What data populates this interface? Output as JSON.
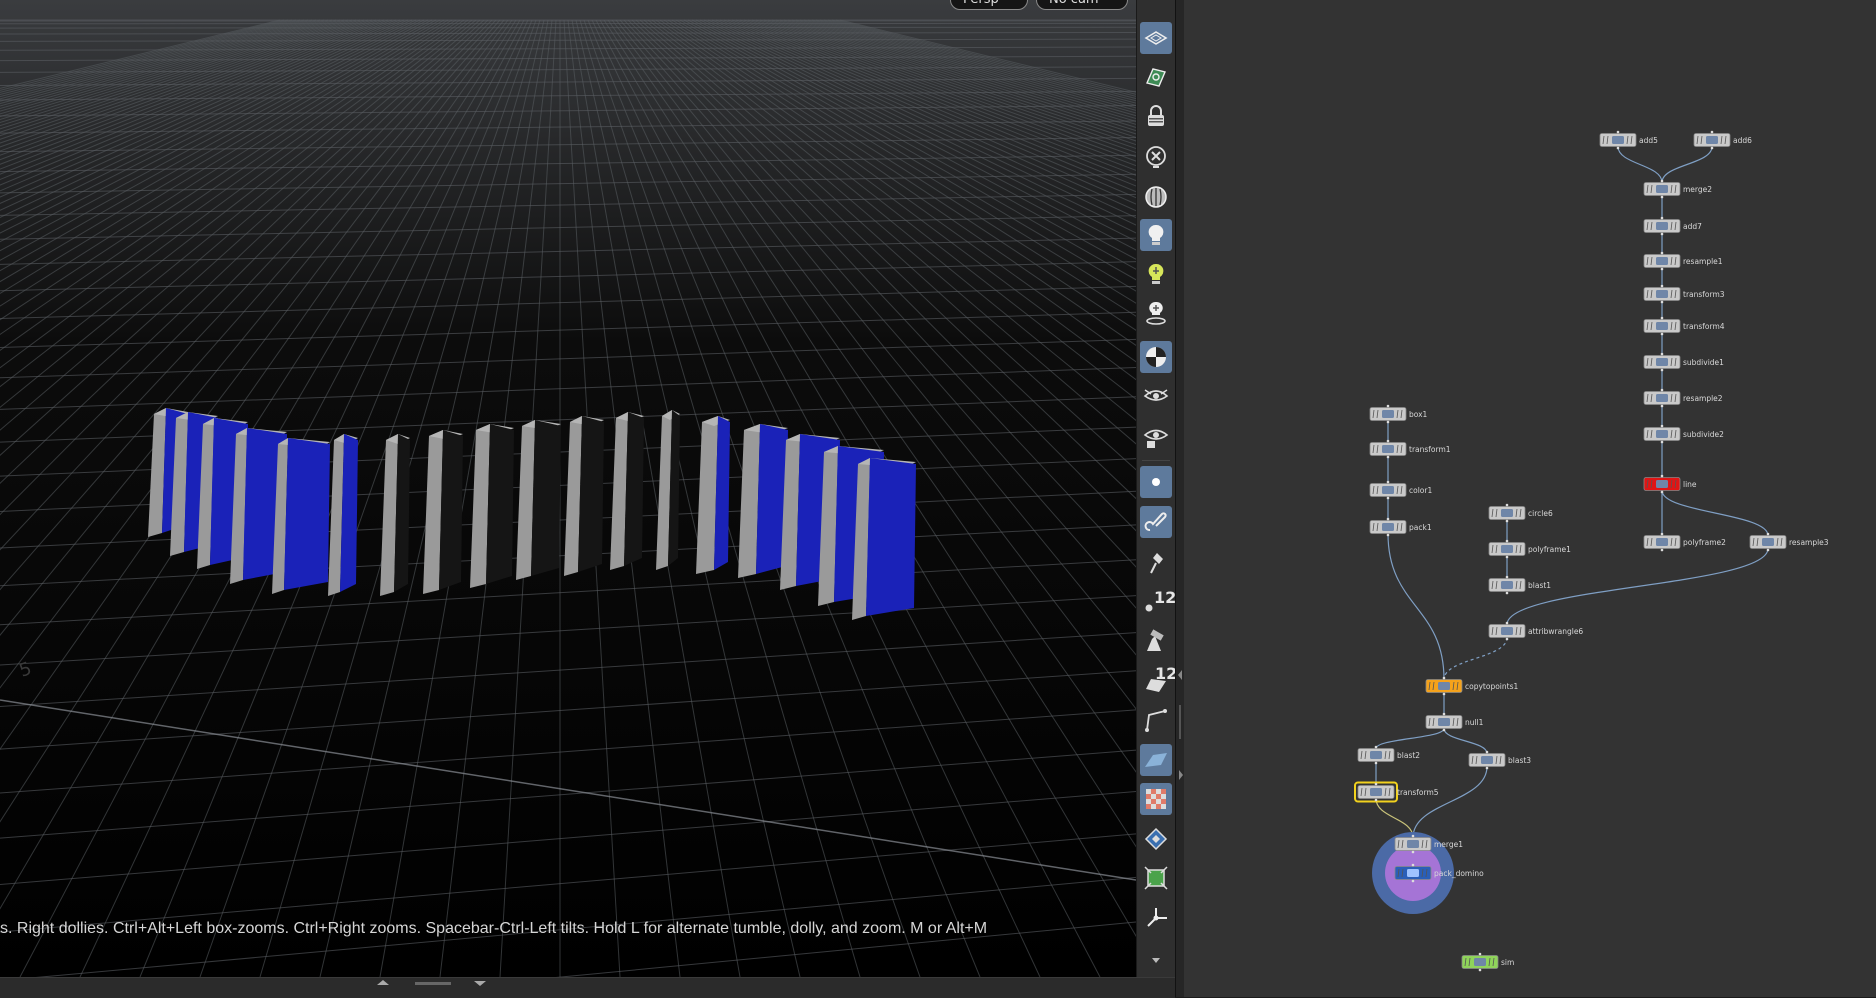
{
  "viewport": {
    "top_buttons": [
      "Persp",
      "No cam"
    ],
    "hint_text": "s. Right dollies. Ctrl+Alt+Left box-zooms. Ctrl+Right zooms. Spacebar-Ctrl-Left tilts. Hold L for alternate tumble, dolly, and zoom.    M or Alt+M",
    "grid_label": "5",
    "colors": {
      "domino_blue": "#1a22b8",
      "domino_side": "#9a9a9a",
      "domino_black": "#151515",
      "background": "#000000"
    }
  },
  "toolbar": {
    "icons": [
      "select-mode-icon",
      "snap-icon",
      "lock-camera-icon",
      "hide-icon",
      "wireframe-icon",
      "headlight-icon",
      "normal-light-icon",
      "high-light-icon",
      "shaded-icon",
      "display-options-icon",
      "visualizer-icon",
      "point-icon",
      "paint-icon",
      "pin-icon",
      "display-points-icon",
      "measure-icon",
      "display-count-icon",
      "edge-icon",
      "ground-plane-icon",
      "checker-icon",
      "vertex-icon",
      "frame-icon",
      "axis-icon",
      "more-icon"
    ],
    "numbers": [
      "12",
      "12"
    ]
  },
  "network": {
    "nodes": [
      {
        "id": "add5",
        "label": "add5"
      },
      {
        "id": "add6",
        "label": "add6"
      },
      {
        "id": "merge2",
        "label": "merge2"
      },
      {
        "id": "add7",
        "label": "add7"
      },
      {
        "id": "resample1",
        "label": "resample1"
      },
      {
        "id": "transform3",
        "label": "transform3"
      },
      {
        "id": "transform4",
        "label": "transform4"
      },
      {
        "id": "subdivide1",
        "label": "subdivide1"
      },
      {
        "id": "resample2",
        "label": "resample2"
      },
      {
        "id": "subdivide2",
        "label": "subdivide2"
      },
      {
        "id": "line",
        "label": "line"
      },
      {
        "id": "box1",
        "label": "box1"
      },
      {
        "id": "transform1",
        "label": "transform1"
      },
      {
        "id": "color1",
        "label": "color1"
      },
      {
        "id": "pack1",
        "label": "pack1"
      },
      {
        "id": "circle6",
        "label": "circle6"
      },
      {
        "id": "polyframe1",
        "label": "polyframe1"
      },
      {
        "id": "blast1",
        "label": "blast1"
      },
      {
        "id": "polyframe2",
        "label": "polyframe2"
      },
      {
        "id": "resample3",
        "label": "resample3"
      },
      {
        "id": "attribwrangle6",
        "label": "attribwrangle6"
      },
      {
        "id": "copytopoints1",
        "label": "copytopoints1"
      },
      {
        "id": "null1",
        "label": "null1"
      },
      {
        "id": "blast2",
        "label": "blast2"
      },
      {
        "id": "blast3",
        "label": "blast3"
      },
      {
        "id": "transform5",
        "label": "transform5"
      },
      {
        "id": "merge1",
        "label": "merge1"
      },
      {
        "id": "pack_domino",
        "label": "pack_domino"
      },
      {
        "id": "sim",
        "label": "sim"
      }
    ],
    "colors": {
      "background": "#333333",
      "wire": "#7f9fc4",
      "copy_node": "#f5a21b",
      "line_node": "#e01515",
      "sim_node": "#8fd45a",
      "display_ring": "#4b6aa6",
      "render_ring": "#a574d6"
    }
  }
}
